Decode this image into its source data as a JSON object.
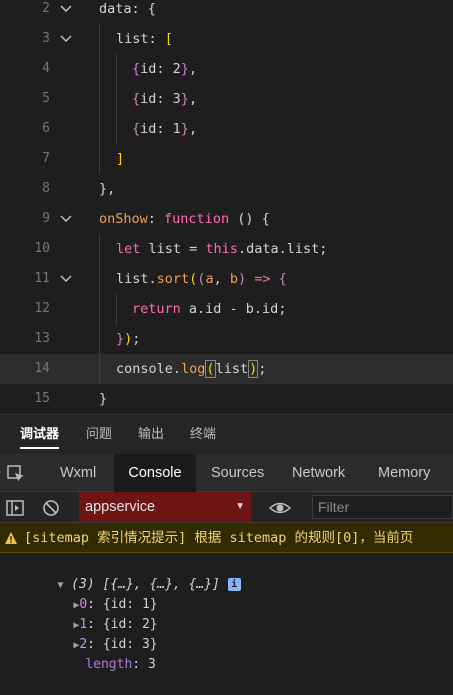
{
  "editor": {
    "lines": [
      {
        "num": "2",
        "fold": true
      },
      {
        "num": "3",
        "fold": true
      },
      {
        "num": "4",
        "fold": false
      },
      {
        "num": "5",
        "fold": false
      },
      {
        "num": "6",
        "fold": false
      },
      {
        "num": "7",
        "fold": false
      },
      {
        "num": "8",
        "fold": false
      },
      {
        "num": "9",
        "fold": true
      },
      {
        "num": "10",
        "fold": false
      },
      {
        "num": "11",
        "fold": true
      },
      {
        "num": "12",
        "fold": false
      },
      {
        "num": "13",
        "fold": false
      },
      {
        "num": "14",
        "fold": false
      },
      {
        "num": "15",
        "fold": false
      }
    ],
    "code": {
      "l2_key": "data",
      "l2_rest": ": {",
      "l3_key": "list",
      "l3_colon": ": ",
      "l3_bracket": "[",
      "l4_open": "{",
      "l4_key": "id",
      "l4_val": ": 2",
      "l4_close": "}",
      "l4_comma": ",",
      "l5_open": "{",
      "l5_key": "id",
      "l5_val": ": 3",
      "l5_close": "}",
      "l5_comma": ",",
      "l6_open": "{",
      "l6_key": "id",
      "l6_val": ": 1",
      "l6_close": "}",
      "l6_comma": ",",
      "l7_bracket": "]",
      "l8_text": "},",
      "l9_name": "onShow",
      "l9_colon": ": ",
      "l9_func": "function",
      "l9_paren": " () {",
      "l10_let": "let",
      "l10_var": " list = ",
      "l10_this": "this",
      "l10_rest": ".data.list;",
      "l11_obj": "list.",
      "l11_fn": "sort",
      "l11_p1": "(",
      "l11_p2": "(",
      "l11_a": "a",
      "l11_sep": ", ",
      "l11_b": "b",
      "l11_p3": ")",
      "l11_arrow": " => ",
      "l11_brace": "{",
      "l12_ret": "return",
      "l12_expr": " a.id - b.id;",
      "l13_brace": "}",
      "l13_paren": ")",
      "l13_semi": ";",
      "l14_obj": "console.",
      "l14_fn": "log",
      "l14_p1": "(",
      "l14_arg": "list",
      "l14_p2": ")",
      "l14_semi": ";",
      "l15_brace": "}"
    }
  },
  "panel_tabs": [
    "调试器",
    "问题",
    "输出",
    "终端"
  ],
  "devtools_tabs": [
    "Wxml",
    "Console",
    "Sources",
    "Network",
    "Memory"
  ],
  "toolbar": {
    "context": "appservice",
    "filter_placeholder": "Filter"
  },
  "warning": {
    "text": "[sitemap 索引情况提示] 根据 sitemap 的规则[0]，当前页"
  },
  "console": {
    "summary": "(3) [{…}, {…}, {…}]",
    "info_badge": "i",
    "items": [
      {
        "key": "0",
        "value": "{id: 1}"
      },
      {
        "key": "1",
        "value": "{id: 2}"
      },
      {
        "key": "2",
        "value": "{id: 3}"
      }
    ],
    "length_key": "length",
    "length_value": "3"
  },
  "colors": {
    "accent_warning_bg": "#332b00",
    "context_select_bg": "#6e1414",
    "info_badge": "#8ab4f8"
  }
}
